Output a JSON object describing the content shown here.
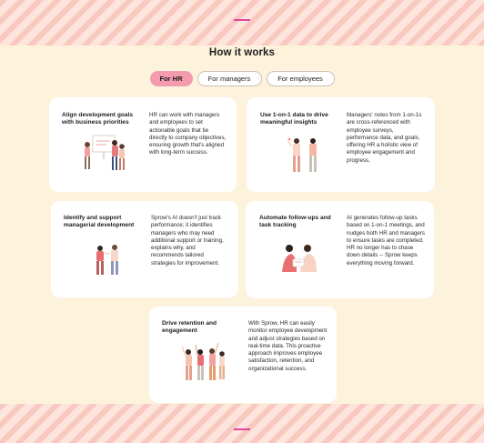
{
  "page": {
    "title": "How it works"
  },
  "tabs": [
    {
      "label": "For HR",
      "active": true
    },
    {
      "label": "For managers",
      "active": false
    },
    {
      "label": "For employees",
      "active": false
    }
  ],
  "cards": [
    {
      "heading": "Align development goals with business priorities",
      "description": "HR can work with managers and employees to set actionable goals that tie directly to company objectives, ensuring growth that's aligned with long-term success.",
      "illustration": "team-planning-whiteboard-illustration"
    },
    {
      "heading": "Use 1-on-1 data to drive meaningful insights",
      "description": "Managers' notes from 1-on-1s are cross-referenced with employee surveys, performance data, and goals, offering HR a holistic view of employee engagement and progress.",
      "illustration": "people-discussing-illustration"
    },
    {
      "heading": "Identify and support managerial development",
      "description": "Sprow's AI doesn't just track performance; it identifies managers who may need additional support or training, explains why, and recommends tailored strategies for improvement.",
      "illustration": "manager-coaching-illustration"
    },
    {
      "heading": "Automate follow-ups and task tracking",
      "description": "AI generates follow-up tasks based on 1-on-1 meetings, and nudges both HR and managers to ensure tasks are completed. HR no longer has to chase down details -- Sprow keeps everything moving forward.",
      "illustration": "colleagues-reviewing-tasks-illustration"
    },
    {
      "heading": "Drive retention and engagement",
      "description": "With Sprow, HR can easily monitor employee development and adjust strategies based on real-time data. This proactive approach improves employee satisfaction, retention, and organizational success.",
      "illustration": "team-celebrating-illustration"
    }
  ],
  "colors": {
    "background": "#fdf3dc",
    "stripe": "#f8c9bf",
    "active_tab": "#f49bb0",
    "accent_dash": "#e0479e",
    "card": "#ffffff"
  }
}
